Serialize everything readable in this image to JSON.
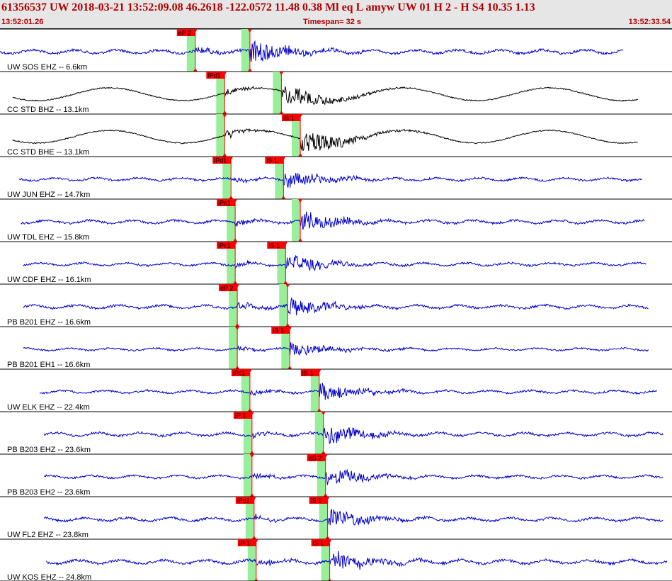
{
  "header": {
    "title": "61356537 UW 2018-03-21 13:52:09.08   46.2618 -122.0572  11.48  0.38 Ml  eq  L amyw     UW 01  H   2  -  H S4    10.35  1.13",
    "start_time": "13:52:01.26",
    "timespan": "Timespan=  32 s",
    "end_time": "13:52:33.54"
  },
  "colors": {
    "blue_trace": "#0000cc",
    "black_trace": "#000000",
    "pick_flag": "#ff0000",
    "pick_window": "#99ee99",
    "header_text": "#b00000"
  },
  "timespan_s": 32,
  "traces": [
    {
      "label": "UW SOS EHZ -- 6.6km",
      "color": "blue",
      "p_label": "eP 2",
      "p_time": 9.3,
      "s_label": "",
      "s_time": 11.9,
      "amp": 0.8,
      "start": 0.0,
      "end": 29.7
    },
    {
      "label": "CC STD BHZ -- 13.1km",
      "color": "black",
      "p_label": "iPd1",
      "p_time": 10.7,
      "s_label": "",
      "s_time": 13.4,
      "amp": 0.8,
      "start": 0.6,
      "end": 30.4
    },
    {
      "label": "CC STD BHE -- 13.1km",
      "color": "black",
      "p_label": "",
      "p_time": 10.7,
      "s_label": "iS 1",
      "s_time": 14.3,
      "amp": 0.9,
      "start": 0.6,
      "end": 30.4
    },
    {
      "label": "UW JUN EHZ -- 14.7km",
      "color": "blue",
      "p_label": "iPd1",
      "p_time": 11.0,
      "s_label": "iS 1",
      "s_time": 13.5,
      "amp": 0.6,
      "start": 0.9,
      "end": 30.6
    },
    {
      "label": "UW TDL EHZ -- 15.8km",
      "color": "blue",
      "p_label": "iPc1",
      "p_time": 11.2,
      "s_label": "",
      "s_time": 14.3,
      "amp": 0.7,
      "start": 1.0,
      "end": 30.7
    },
    {
      "label": "UW CDF EHZ -- 16.1km",
      "color": "blue",
      "p_label": "iPc1",
      "p_time": 11.2,
      "s_label": "iS 1",
      "s_time": 13.6,
      "amp": 0.6,
      "start": 1.1,
      "end": 30.8
    },
    {
      "label": "PB B201 EHZ -- 16.6km",
      "color": "blue",
      "p_label": "eP 2",
      "p_time": 11.3,
      "s_label": "",
      "s_time": 13.7,
      "amp": 0.7,
      "start": 1.1,
      "end": 30.9
    },
    {
      "label": "PB B201 EH1 -- 16.6km",
      "color": "blue",
      "p_label": "",
      "p_time": 11.3,
      "s_label": "iS 1",
      "s_time": 13.8,
      "amp": 0.5,
      "start": 1.1,
      "end": 30.9
    },
    {
      "label": "UW ELK EHZ -- 22.4km",
      "color": "blue",
      "p_label": "iPc1",
      "p_time": 11.9,
      "s_label": "iS 1",
      "s_time": 15.2,
      "amp": 0.6,
      "start": 1.9,
      "end": 31.3
    },
    {
      "label": "PB B203 EHZ -- 23.6km",
      "color": "blue",
      "p_label": "iP 1",
      "p_time": 12.0,
      "s_label": "",
      "s_time": 15.4,
      "amp": 0.7,
      "start": 2.1,
      "end": 31.6
    },
    {
      "label": "PB B203 EH2 -- 23.6km",
      "color": "blue",
      "p_label": "",
      "p_time": 12.0,
      "s_label": "eS 2",
      "s_time": 15.5,
      "amp": 0.6,
      "start": 2.1,
      "end": 31.6
    },
    {
      "label": "UW FL2 EHZ -- 23.8km",
      "color": "blue",
      "p_label": "iPc1",
      "p_time": 12.1,
      "s_label": "iS 1",
      "s_time": 15.6,
      "amp": 0.7,
      "start": 2.1,
      "end": 31.6
    },
    {
      "label": "UW KOS EHZ -- 24.8km",
      "color": "blue",
      "p_label": "iP 1",
      "p_time": 12.2,
      "s_label": "iS 1",
      "s_time": 15.7,
      "amp": 0.8,
      "start": 2.2,
      "end": 31.8
    }
  ]
}
